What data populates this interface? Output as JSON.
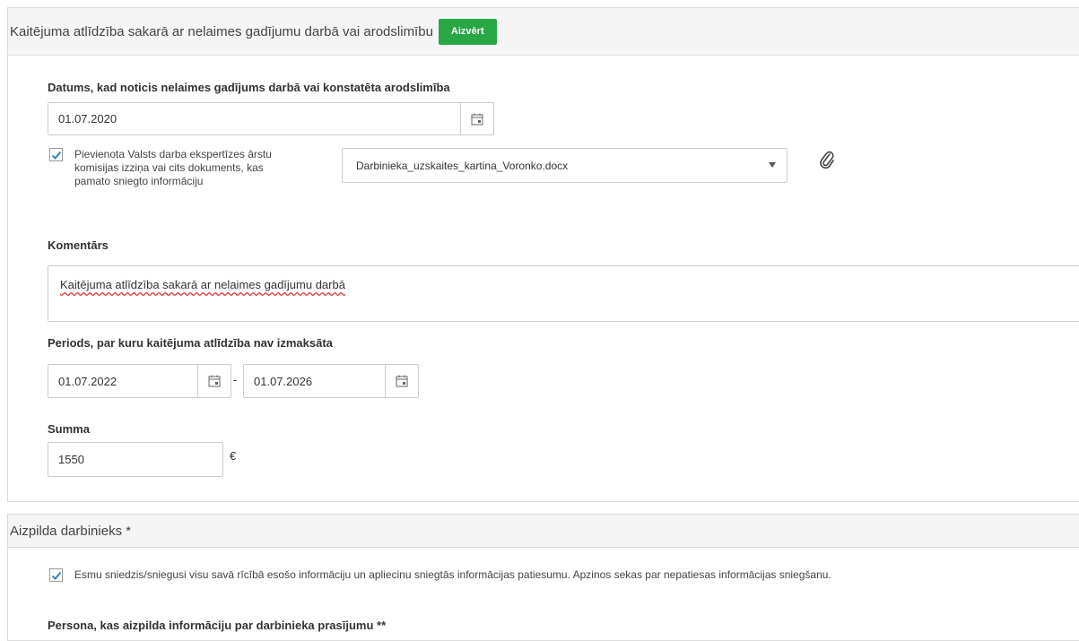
{
  "section1": {
    "title": "Kaitējuma atlīdzība sakarā ar nelaimes gadījumu darbā vai arodslimību",
    "close_label": "Aizvērt",
    "date_label": "Datums, kad noticis nelaimes gadījums darbā vai konstatēta arodslimība",
    "date_value": "01.07.2020",
    "attachment_checkbox_text": "Pievienota Valsts darba ekspertīzes ārstu komisijas izziņa vai cits dokuments, kas pamato sniegto informāciju",
    "attachment_checked": true,
    "attachment_file": "Darbinieka_uzskaites_kartina_Voronko.docx",
    "comment_label": "Komentārs",
    "comment_value": "Kaitējuma atlīdzība sakarā ar nelaimes gadījumu darbā",
    "period_label": "Periods, par kuru kaitējuma atlīdzība nav izmaksāta",
    "period_from": "01.07.2022",
    "period_separator": "-",
    "period_to": "01.07.2026",
    "sum_label": "Summa",
    "sum_value": "1550",
    "currency": "€"
  },
  "section2": {
    "title": "Aizpilda darbinieks *",
    "confirm_text": "Esmu sniedzis/sniegusi visu savā rīcībā esošo informāciju un apliecinu sniegtās informācijas patiesumu. Apzinos sekas par nepatiesas informācijas sniegšanu.",
    "confirm_checked": true,
    "person_label": "Persona, kas aizpilda informāciju par darbinieka prasījumu **"
  },
  "colors": {
    "accent_green": "#28a745",
    "check_blue": "#2a7ab8",
    "panel_head": "#f5f5f5",
    "border": "#dcdcdc"
  },
  "icons": [
    "calendar-icon",
    "paperclip-icon",
    "check-icon",
    "chevron-down-icon"
  ]
}
